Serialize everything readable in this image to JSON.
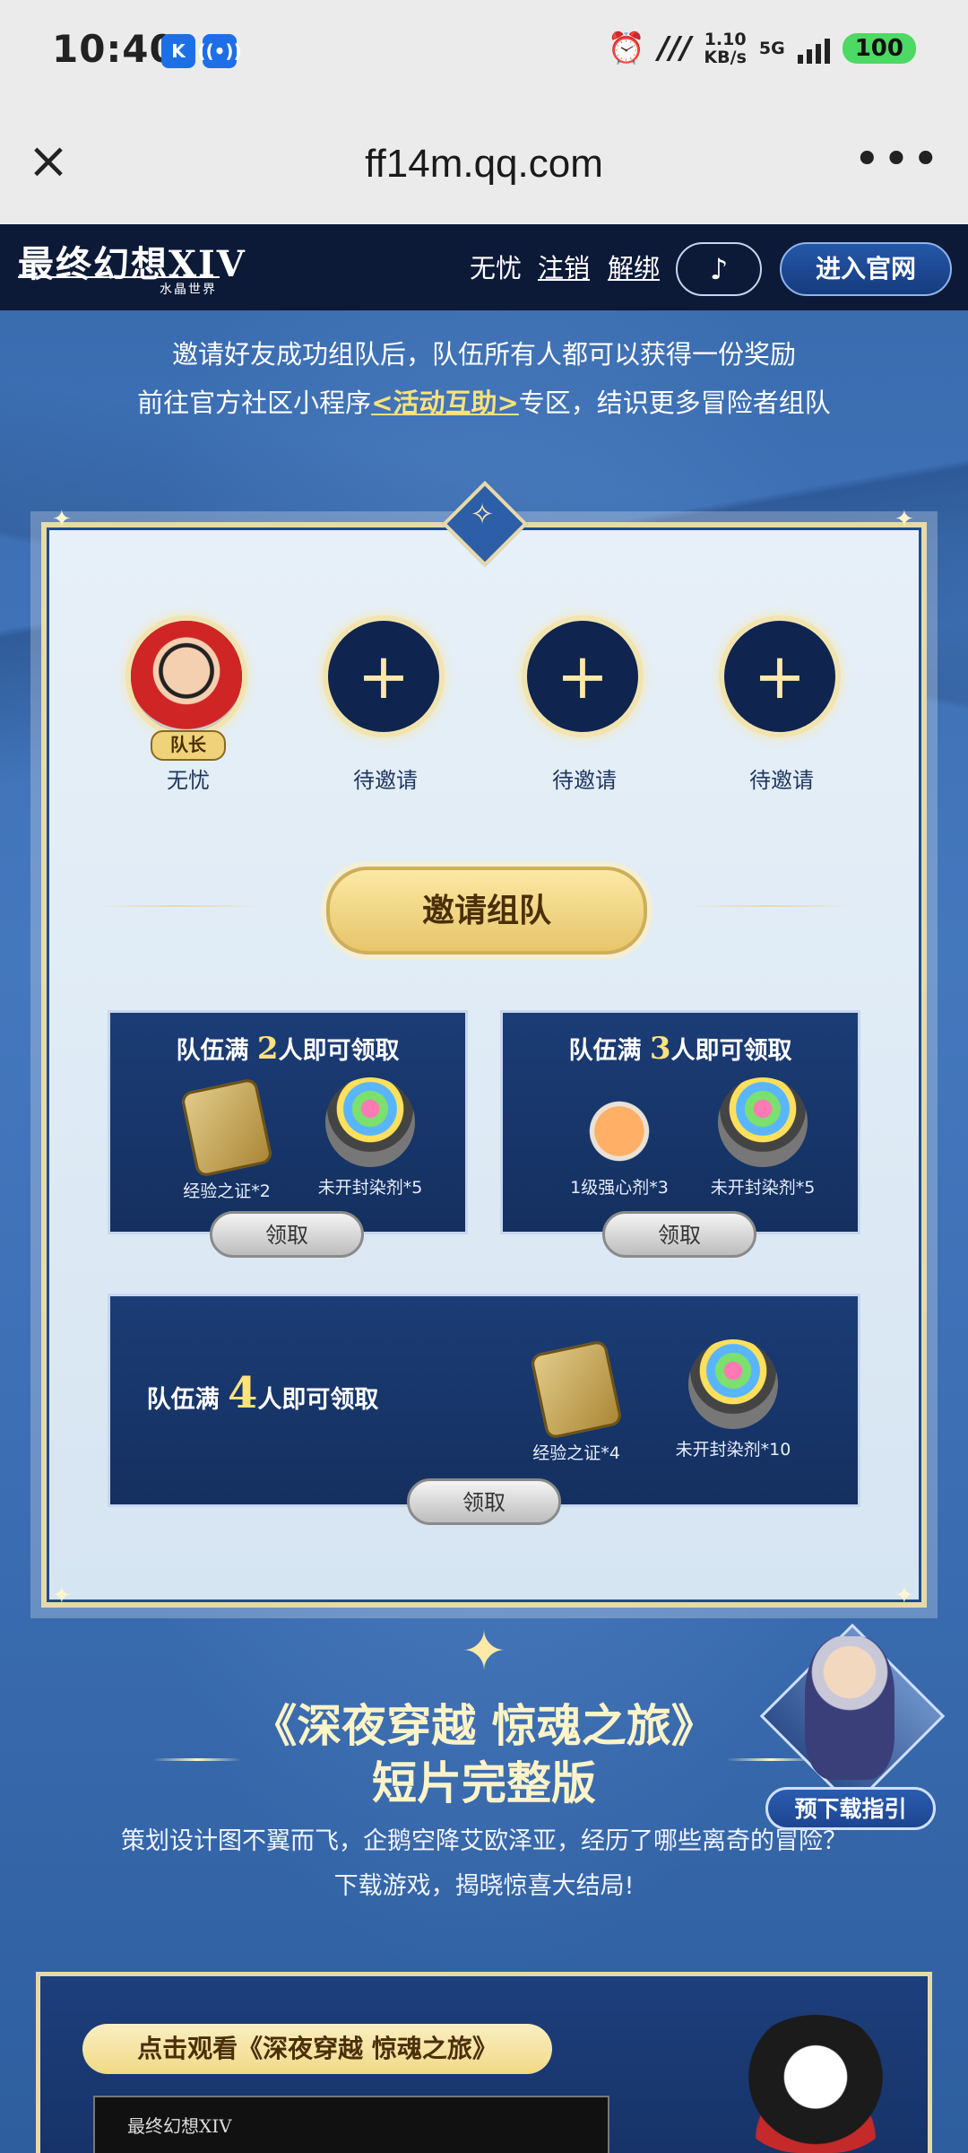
{
  "status_bar": {
    "time": "10:40",
    "speed_value": "1.10",
    "speed_unit": "KB/s",
    "network": "5G",
    "battery": "100"
  },
  "address_bar": {
    "url": "ff14m.qq.com"
  },
  "header": {
    "logo_text": "最终幻想XIV",
    "logo_sub": "水晶世界",
    "username": "无忧",
    "logout_label": "注销",
    "unbind_label": "解绑",
    "official_label": "进入官网"
  },
  "intro": {
    "line1": "邀请好友成功组队后，队伍所有人都可以获得一份奖励",
    "line2_prefix": "前往官方社区小程序",
    "line2_link": "<活动互助>",
    "line2_suffix": "专区，结识更多冒险者组队"
  },
  "team": {
    "members": [
      {
        "name": "无忧",
        "badge": "队长"
      },
      {
        "name": "待邀请"
      },
      {
        "name": "待邀请"
      },
      {
        "name": "待邀请"
      }
    ],
    "invite_label": "邀请组队"
  },
  "rewards": [
    {
      "title_prefix": "队伍满",
      "count": "2",
      "title_suffix": "人即可领取",
      "items": [
        "经验之证*2",
        "未开封染剂*5"
      ],
      "claim_label": "领取"
    },
    {
      "title_prefix": "队伍满",
      "count": "3",
      "title_suffix": "人即可领取",
      "items": [
        "1级强心剂*3",
        "未开封染剂*5"
      ],
      "claim_label": "领取"
    },
    {
      "title_prefix": "队伍满",
      "count": "4",
      "title_suffix": "人即可领取",
      "items": [
        "经验之证*4",
        "未开封染剂*10"
      ],
      "claim_label": "领取"
    }
  ],
  "video_section": {
    "title_line1": "《深夜穿越 惊魂之旅》",
    "title_line2": "短片完整版",
    "desc_line1": "策划设计图不翼而飞，企鹅空降艾欧泽亚，经历了哪些离奇的冒险？",
    "desc_line2": "下载游戏，揭晓惊喜大结局!",
    "guide_label": "预下载指引",
    "watch_label": "点击观看《深夜穿越 惊魂之旅》",
    "thumb_logo": "最终幻想XIV"
  }
}
